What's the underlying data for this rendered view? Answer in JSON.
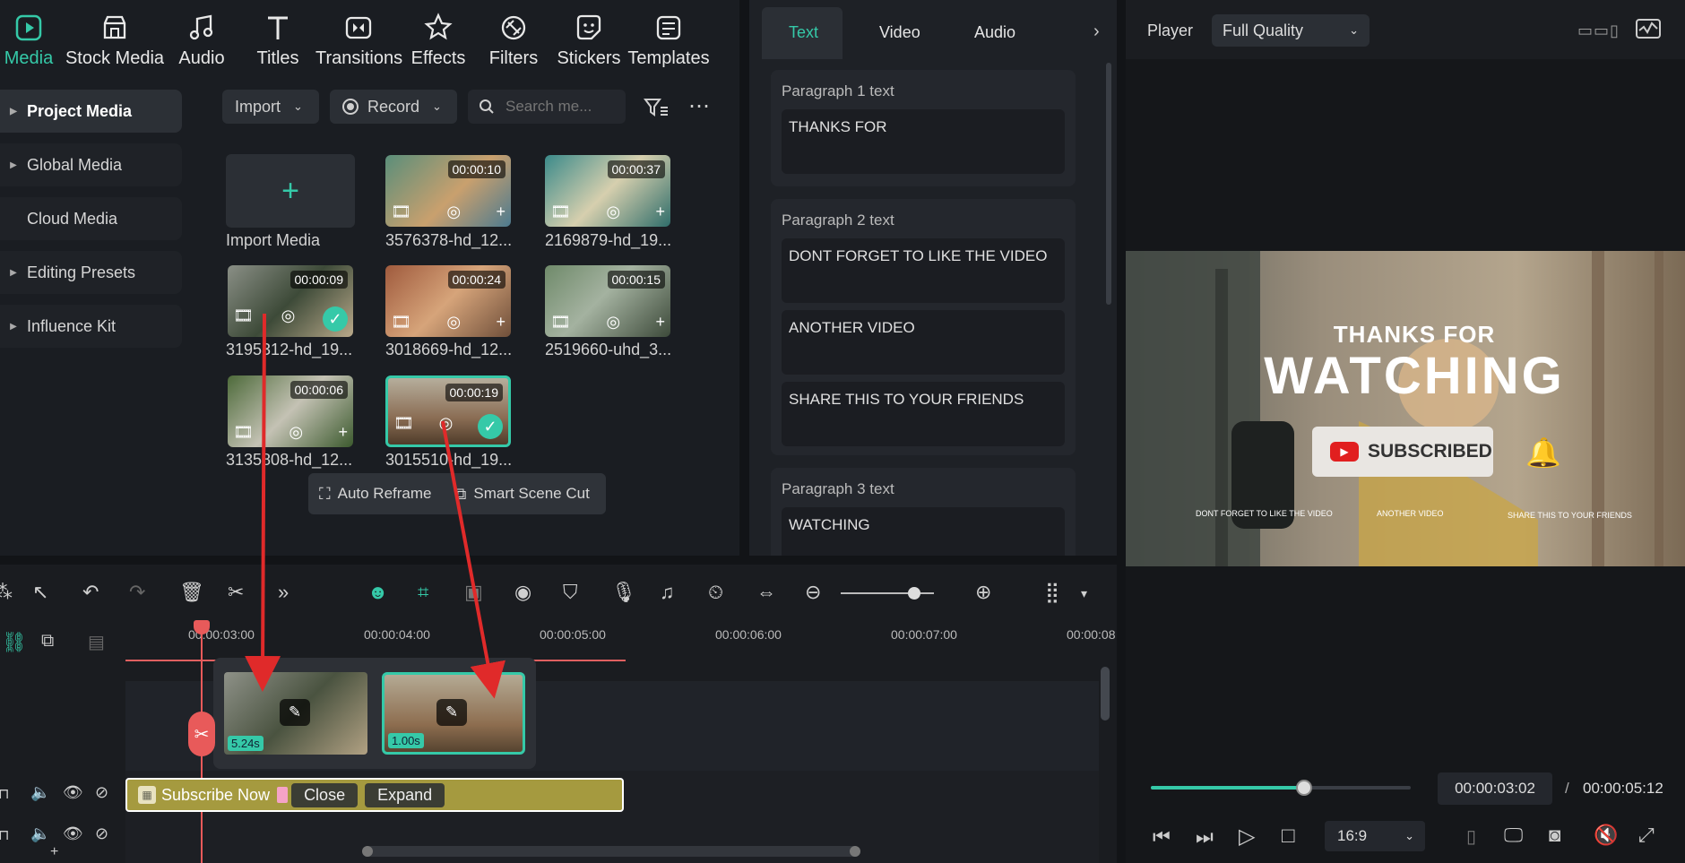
{
  "toolbar": {
    "tabs": [
      {
        "label": "Media",
        "icon": "media-icon"
      },
      {
        "label": "Stock Media",
        "icon": "stock-media-icon"
      },
      {
        "label": "Audio",
        "icon": "audio-icon"
      },
      {
        "label": "Titles",
        "icon": "titles-icon"
      },
      {
        "label": "Transitions",
        "icon": "transitions-icon"
      },
      {
        "label": "Effects",
        "icon": "effects-icon"
      },
      {
        "label": "Filters",
        "icon": "filters-icon"
      },
      {
        "label": "Stickers",
        "icon": "stickers-icon"
      },
      {
        "label": "Templates",
        "icon": "templates-icon"
      }
    ],
    "active": "Media",
    "accent": "#35c9a8"
  },
  "sidebar": {
    "items": [
      {
        "label": "Project Media",
        "expandable": true,
        "active": true
      },
      {
        "label": "Global Media",
        "expandable": true
      },
      {
        "label": "Cloud Media",
        "expandable": false
      },
      {
        "label": "Editing Presets",
        "expandable": true
      },
      {
        "label": "Influence Kit",
        "expandable": true
      }
    ]
  },
  "media_toolbar": {
    "import_label": "Import",
    "record_label": "Record",
    "search_placeholder": "Search me..."
  },
  "media": {
    "import_label": "Import Media",
    "items": [
      {
        "name": "3576378-hd_12...",
        "duration": "00:00:10",
        "selected": false
      },
      {
        "name": "2169879-hd_19...",
        "duration": "00:00:37",
        "selected": false
      },
      {
        "name": "3195312-hd_19...",
        "duration": "00:00:09",
        "selected": true
      },
      {
        "name": "3018669-hd_12...",
        "duration": "00:00:24",
        "selected": false
      },
      {
        "name": "2519660-uhd_3...",
        "duration": "00:00:15",
        "selected": false
      },
      {
        "name": "3135808-hd_12...",
        "duration": "00:00:06",
        "selected": false
      },
      {
        "name": "3015510-hd_19...",
        "duration": "00:00:19",
        "selected": true
      }
    ],
    "context_menu": {
      "auto_reframe": "Auto Reframe",
      "smart_scene_cut": "Smart Scene Cut"
    }
  },
  "properties": {
    "tabs": [
      "Text",
      "Video",
      "Audio"
    ],
    "active_tab": "Text",
    "paragraphs": [
      {
        "title": "Paragraph 1 text",
        "fields": [
          "THANKS FOR"
        ]
      },
      {
        "title": "Paragraph 2 text",
        "fields": [
          "DONT FORGET TO LIKE THE VIDEO",
          "ANOTHER VIDEO",
          "SHARE THIS TO YOUR FRIENDS"
        ]
      },
      {
        "title": "Paragraph 3 text",
        "fields": [
          "WATCHING"
        ]
      }
    ]
  },
  "player": {
    "label": "Player",
    "quality": "Full Quality",
    "overlay": {
      "line1": "THANKS FOR",
      "line2": "WATCHING",
      "button": "SUBSCRIBED",
      "small1": "DONT FORGET TO LIKE THE VIDEO",
      "small2": "ANOTHER VIDEO",
      "small3": "SHARE THIS TO YOUR FRIENDS"
    },
    "progress": 0.59,
    "current_time": "00:00:03:02",
    "separator": "/",
    "total_time": "00:00:05:12",
    "aspect": "16:9"
  },
  "timeline": {
    "ruler": [
      "00:00:03:00",
      "00:00:04:00",
      "00:00:05:00",
      "00:00:06:00",
      "00:00:07:00",
      "00:00:08"
    ],
    "clips": [
      {
        "duration": "5.24s"
      },
      {
        "duration": "1.00s"
      }
    ],
    "title_clip": {
      "label": "Subscribe Now",
      "close": "Close",
      "expand": "Expand",
      "color": "#a59a3f"
    },
    "zoom_level": 0.79
  }
}
